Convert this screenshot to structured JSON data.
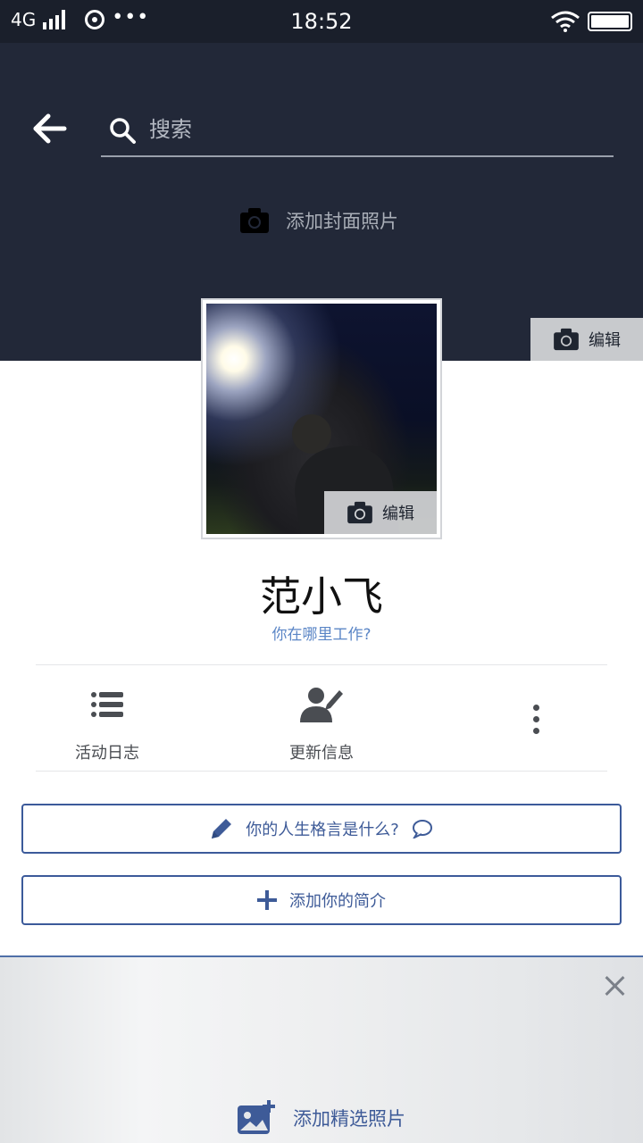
{
  "status_bar": {
    "network": "4G",
    "time": "18:52",
    "dots": "•••"
  },
  "search": {
    "placeholder": "搜索"
  },
  "cover": {
    "add_cover_label": "添加封面照片",
    "edit_label": "编辑"
  },
  "profile": {
    "photo_edit_label": "编辑",
    "name": "范小飞",
    "work_prompt": "你在哪里工作?"
  },
  "actions": {
    "activity_log": "活动日志",
    "update_info": "更新信息"
  },
  "buttons": {
    "motto": "你的人生格言是什么?",
    "add_bio": "添加你的简介"
  },
  "featured": {
    "add_label": "添加精选照片"
  },
  "colors": {
    "cover_bg": "#222838",
    "accent": "#3e5b98",
    "link": "#5b86c6"
  }
}
